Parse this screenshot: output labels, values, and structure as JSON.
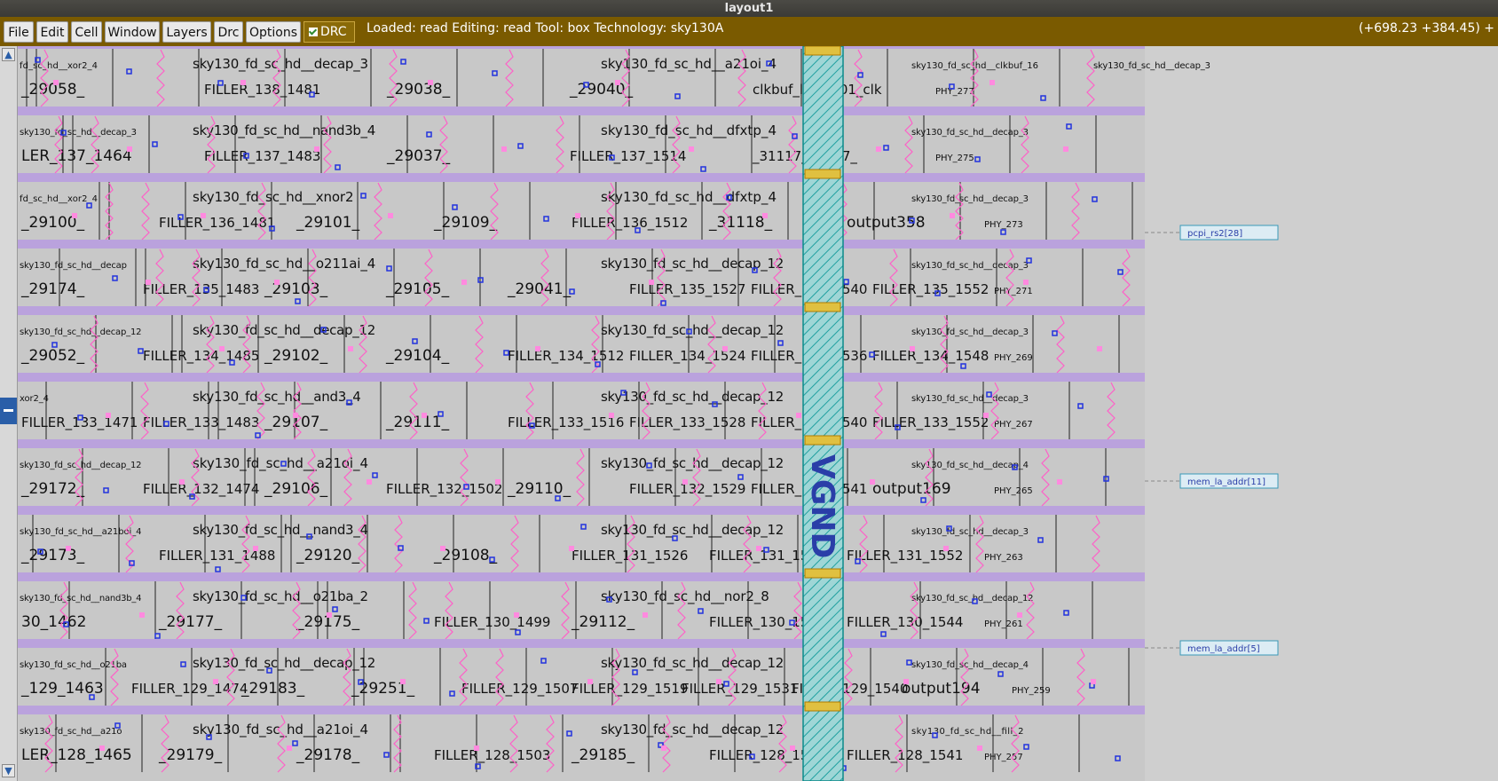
{
  "window": {
    "title": "layout1"
  },
  "menu": [
    "File",
    "Edit",
    "Cell",
    "Window",
    "Layers",
    "Drc",
    "Options"
  ],
  "drc": {
    "label": "DRC",
    "checked": true
  },
  "status": "Loaded: read  Editing: read  Tool: box   Technology: sky130A",
  "coords": "(+698.23 +384.45) +",
  "colors": {
    "menubar": "#7a5a00",
    "cellbg": "#c8c8c8",
    "rail": "#b79be0",
    "wire": "#ff5fc8",
    "via": "#2233dd",
    "vgnd": "#20b2b2"
  },
  "vgnd_label": "VGND",
  "pins": [
    "pcpi_rs2[28]",
    "mem_la_addr[11]",
    "mem_la_addr[5]"
  ],
  "rows": [
    {
      "small": [
        "fd_sc_hd__xor2_4",
        "sky130_fd_sc_hd__decap_3",
        "sky130_fd_sc_hd__a21oi_4",
        "sky130_fd_sc_hd__clkbuf_16",
        "sky130_fd_sc_hd__decap_3"
      ],
      "big": [
        "_29058_",
        "FILLER_138_1481",
        "_29038_",
        "_29040_",
        "clkbuf_leaf_101_clk",
        "PHY_277"
      ]
    },
    {
      "small": [
        "sky130_fd_sc_hd__decap_3",
        "sky130_fd_sc_hd__nand3b_4",
        "sky130_fd_sc_hd__dfxtp_4",
        "sky130_fd_sc_hd__decap_3"
      ],
      "big": [
        "LER_137_1464",
        "FILLER_137_1483",
        "_29037_",
        "FILLER_137_1514",
        "_31117_31117_",
        "PHY_275"
      ]
    },
    {
      "small": [
        "fd_sc_hd__xor2_4",
        "sky130_fd_sc_hd__xnor2",
        "sky130_fd_sc_hd__dfxtp_4",
        "sky130_fd_sc_hd__decap_3"
      ],
      "big": [
        "_29100_",
        "FILLER_136_1481",
        "_29101_",
        "_29109_",
        "FILLER_136_1512",
        "_31118_",
        "output358",
        "PHY_273"
      ]
    },
    {
      "small": [
        "sky130_fd_sc_hd__decap",
        "sky130_fd_sc_hd__o211ai_4",
        "sky130_fd_sc_hd__decap_12",
        "sky130_fd_sc_hd__decap_3"
      ],
      "big": [
        "_29174_",
        "FILLER_135_1483",
        "_29103_",
        "_29105_",
        "_29041_",
        "FILLER_135_1527",
        "FILLER_135_1540",
        "FILLER_135_1552",
        "PHY_271"
      ]
    },
    {
      "small": [
        "sky130_fd_sc_hd__decap_12",
        "sky130_fd_sc_hd__decap_12",
        "sky130_fd_sc_hd__decap_12",
        "sky130_fd_sc_hd__decap_3"
      ],
      "big": [
        "_29052_",
        "FILLER_134_1485",
        "_29102_",
        "_29104_",
        "FILLER_134_1512",
        "FILLER_134_1524",
        "FILLER_134_1536",
        "FILLER_134_1548",
        "PHY_269"
      ]
    },
    {
      "small": [
        "xor2_4",
        "sky130_fd_sc_hd__and3_4",
        "sky130_fd_sc_hd__decap_12",
        "sky130_fd_sc_hd__decap_3"
      ],
      "big": [
        "FILLER_133_1471",
        "FILLER_133_1483",
        "_29107_",
        "_29111_",
        "FILLER_133_1516",
        "FILLER_133_1528",
        "FILLER_133_1540",
        "FILLER_133_1552",
        "PHY_267"
      ]
    },
    {
      "small": [
        "sky130_fd_sc_hd__decap_12",
        "sky130_fd_sc_hd__a21oi_4",
        "sky130_fd_sc_hd__decap_12",
        "sky130_fd_sc_hd__decap_4"
      ],
      "big": [
        "_29172_",
        "FILLER_132_1474",
        "_29106_",
        "FILLER_132_1502",
        "_29110_",
        "FILLER_132_1529",
        "FILLER_132_1541",
        "output169",
        "PHY_265"
      ]
    },
    {
      "small": [
        "sky130_fd_sc_hd__a21boi_4",
        "sky130_fd_sc_hd__nand3_4",
        "sky130_fd_sc_hd__decap_12",
        "sky130_fd_sc_hd__decap_3"
      ],
      "big": [
        "_29173_",
        "FILLER_131_1488",
        "_29120_",
        "_29108_",
        "FILLER_131_1526",
        "FILLER_131_1540",
        "FILLER_131_1552",
        "PHY_263"
      ]
    },
    {
      "small": [
        "sky130_fd_sc_hd__nand3b_4",
        "sky130_fd_sc_hd__o21ba_2",
        "sky130_fd_sc_hd__nor2_8",
        "sky130_fd_sc_hd__decap_12"
      ],
      "big": [
        "30_1462",
        "_29177_",
        "_29175_",
        "FILLER_130_1499",
        "_29112_",
        "FILLER_130_1532",
        "FILLER_130_1544",
        "PHY_261"
      ]
    },
    {
      "small": [
        "sky130_fd_sc_hd__o21ba",
        "sky130_fd_sc_hd__decap_12",
        "sky130_fd_sc_hd__decap_12",
        "sky130_fd_sc_hd__decap_4"
      ],
      "big": [
        "_129_1463",
        "FILLER_129_1474",
        "_29183_",
        "_29251_",
        "FILLER_129_1507",
        "FILLER_129_1519",
        "FILLER_129_1531",
        "FILLER_129_1540",
        "output194",
        "PHY_259"
      ]
    },
    {
      "small": [
        "sky130_fd_sc_hd__a21o",
        "sky130_fd_sc_hd__a21oi_4",
        "sky130_fd_sc_hd__decap_12",
        "sky130_fd_sc_hd__fill_2"
      ],
      "big": [
        "LER_128_1465",
        "_29179_",
        "_29178_",
        "FILLER_128_1503",
        "_29185_",
        "FILLER_128_1529",
        "FILLER_128_1541",
        "PHY_257"
      ]
    }
  ]
}
